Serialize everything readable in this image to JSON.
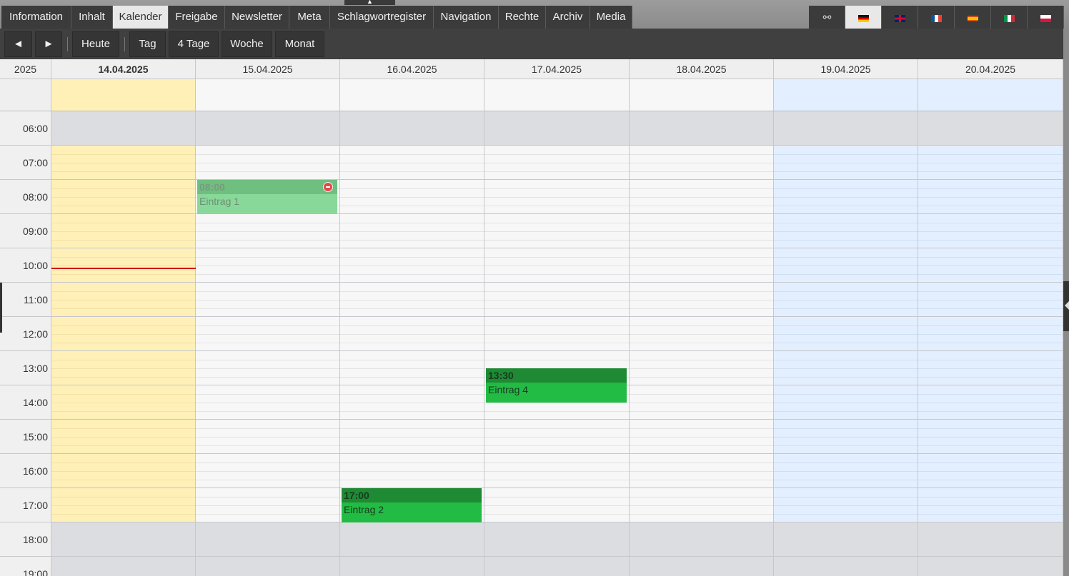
{
  "tabs": [
    {
      "label": "Information",
      "active": false
    },
    {
      "label": "Inhalt",
      "active": false
    },
    {
      "label": "Kalender",
      "active": true
    },
    {
      "label": "Freigabe",
      "active": false
    },
    {
      "label": "Newsletter",
      "active": false
    },
    {
      "label": "Meta",
      "active": false
    },
    {
      "label": "Schlagwortregister",
      "active": false
    },
    {
      "label": "Navigation",
      "active": false
    },
    {
      "label": "Rechte",
      "active": false
    },
    {
      "label": "Archiv",
      "active": false
    },
    {
      "label": "Media",
      "active": false
    }
  ],
  "languages": [
    {
      "icon": "link-icon",
      "active": false
    },
    {
      "icon": "flag-de-icon",
      "active": true
    },
    {
      "icon": "flag-gb-icon",
      "active": false
    },
    {
      "icon": "flag-fr-icon",
      "active": false
    },
    {
      "icon": "flag-es-icon",
      "active": false
    },
    {
      "icon": "flag-it-icon",
      "active": false
    },
    {
      "icon": "flag-pl-icon",
      "active": false
    }
  ],
  "toolbar": {
    "prev_label": "◄",
    "next_label": "►",
    "today_label": "Heute",
    "day_label": "Tag",
    "four_days_label": "4 Tage",
    "week_label": "Woche",
    "month_label": "Monat"
  },
  "calendar": {
    "year": "2025",
    "days": [
      {
        "date": "14.04.2025",
        "today": true,
        "weekend": false
      },
      {
        "date": "15.04.2025",
        "today": false,
        "weekend": false
      },
      {
        "date": "16.04.2025",
        "today": false,
        "weekend": false
      },
      {
        "date": "17.04.2025",
        "today": false,
        "weekend": false
      },
      {
        "date": "18.04.2025",
        "today": false,
        "weekend": false
      },
      {
        "date": "19.04.2025",
        "today": false,
        "weekend": true
      },
      {
        "date": "20.04.2025",
        "today": false,
        "weekend": true
      }
    ],
    "hours": [
      "06:00",
      "07:00",
      "08:00",
      "09:00",
      "10:00",
      "11:00",
      "12:00",
      "13:00",
      "14:00",
      "15:00",
      "16:00",
      "17:00",
      "18:00",
      "19:00"
    ],
    "work_hours": {
      "start": 7,
      "end": 18
    },
    "first_hour": 6,
    "now": 10.58,
    "events": [
      {
        "day": 1,
        "start": 8,
        "time": "08:00",
        "title": "Eintrag 1",
        "faded": true
      },
      {
        "day": 3,
        "start": 13.5,
        "time": "13:30",
        "title": "Eintrag 4",
        "faded": false
      },
      {
        "day": 2,
        "start": 17,
        "time": "17:00",
        "title": "Eintrag 2",
        "faded": false
      }
    ],
    "colors": {
      "today": "#fff0b8",
      "weekend": "#e3efff",
      "offhours": "#dcdde0",
      "event": "#22bb44",
      "event_header": "#1e8a34",
      "now_line": "#d01010"
    }
  }
}
